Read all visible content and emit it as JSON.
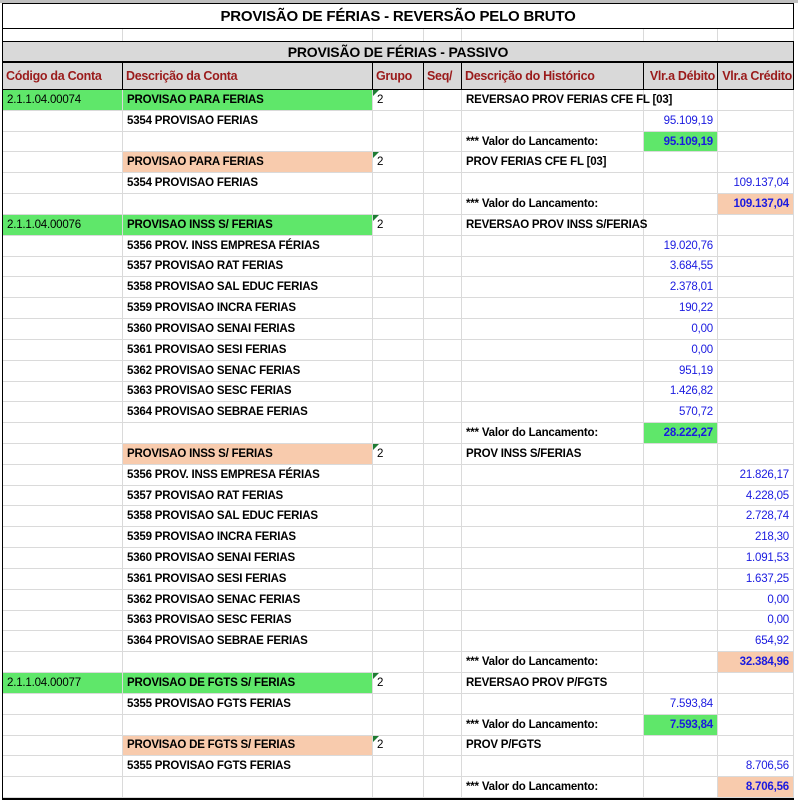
{
  "titles": {
    "main": "PROVISÃO DE FÉRIAS - REVERSÃO PELO BRUTO",
    "section": "PROVISÃO DE FÉRIAS - PASSIVO"
  },
  "columns": [
    {
      "label": "Código da Conta"
    },
    {
      "label": "Descrição da Conta"
    },
    {
      "label": "Grupo"
    },
    {
      "label": "Seq/"
    },
    {
      "label": "Descrição do Histórico"
    },
    {
      "label": "Vlr.a Débito"
    },
    {
      "label": "Vlr.a Crédito"
    }
  ],
  "colors": {
    "highlight_green": "#5FE76A",
    "highlight_orange": "#F8CBAD",
    "value_blue": "#1A1AE0",
    "header_text_red": "#9A1B1B",
    "header_bg_gray": "#D9D9D9",
    "error_indicator_green": "#1E7B33"
  },
  "rows": [
    {
      "code": "2.1.1.04.00074",
      "code_hl": "green",
      "desc": "PROVISAO PARA FERIAS",
      "desc_hl": "green",
      "grupo": "2",
      "hist": "REVERSAO PROV FERIAS CFE FL [03]"
    },
    {
      "desc": "5354 PROVISAO FERIAS",
      "debito": "95.109,19"
    },
    {
      "hist": "*** Valor do Lancamento:",
      "debito": "95.109,19",
      "debito_hl": "green",
      "total": true
    },
    {
      "desc": "PROVISAO PARA FERIAS",
      "desc_hl": "orange",
      "grupo": "2",
      "hist": "PROV FERIAS CFE FL [03]"
    },
    {
      "desc": "5354 PROVISAO FERIAS",
      "credito": "109.137,04"
    },
    {
      "hist": "*** Valor do Lancamento:",
      "credito": "109.137,04",
      "credito_hl": "orange",
      "total": true
    },
    {
      "code": "2.1.1.04.00076",
      "code_hl": "green",
      "desc": "PROVISAO INSS S/ FERIAS",
      "desc_hl": "green",
      "grupo": "2",
      "hist": "REVERSAO PROV INSS S/FERIAS"
    },
    {
      "desc": "5356 PROV. INSS EMPRESA FÉRIAS",
      "debito": "19.020,76"
    },
    {
      "desc": "5357 PROVISAO RAT FERIAS",
      "debito": "3.684,55"
    },
    {
      "desc": "5358 PROVISAO SAL EDUC FERIAS",
      "debito": "2.378,01"
    },
    {
      "desc": "5359 PROVISAO INCRA FERIAS",
      "debito": "190,22"
    },
    {
      "desc": "5360 PROVISAO SENAI FERIAS",
      "debito": "0,00"
    },
    {
      "desc": "5361 PROVISAO SESI FERIAS",
      "debito": "0,00"
    },
    {
      "desc": "5362 PROVISAO SENAC FERIAS",
      "debito": "951,19"
    },
    {
      "desc": "5363 PROVISAO SESC FERIAS",
      "debito": "1.426,82"
    },
    {
      "desc": "5364 PROVISAO SEBRAE FERIAS",
      "debito": "570,72"
    },
    {
      "hist": "*** Valor do Lancamento:",
      "debito": "28.222,27",
      "debito_hl": "green",
      "total": true
    },
    {
      "desc": "PROVISAO INSS S/ FERIAS",
      "desc_hl": "orange",
      "grupo": "2",
      "hist": "PROV INSS S/FERIAS"
    },
    {
      "desc": "5356 PROV. INSS EMPRESA FÉRIAS",
      "credito": "21.826,17"
    },
    {
      "desc": "5357 PROVISAO RAT FERIAS",
      "credito": "4.228,05"
    },
    {
      "desc": "5358 PROVISAO SAL EDUC FERIAS",
      "credito": "2.728,74"
    },
    {
      "desc": "5359 PROVISAO INCRA FERIAS",
      "credito": "218,30"
    },
    {
      "desc": "5360 PROVISAO SENAI FERIAS",
      "credito": "1.091,53"
    },
    {
      "desc": "5361 PROVISAO SESI FERIAS",
      "credito": "1.637,25"
    },
    {
      "desc": "5362 PROVISAO SENAC FERIAS",
      "credito": "0,00"
    },
    {
      "desc": "5363 PROVISAO SESC FERIAS",
      "credito": "0,00"
    },
    {
      "desc": "5364 PROVISAO SEBRAE FERIAS",
      "credito": "654,92"
    },
    {
      "hist": "*** Valor do Lancamento:",
      "credito": "32.384,96",
      "credito_hl": "orange",
      "total": true
    },
    {
      "code": "2.1.1.04.00077",
      "code_hl": "green",
      "desc": "PROVISAO DE FGTS S/ FERIAS",
      "desc_hl": "green",
      "grupo": "2",
      "hist": "REVERSAO PROV P/FGTS"
    },
    {
      "desc": "5355 PROVISAO FGTS FERIAS",
      "debito": "7.593,84"
    },
    {
      "hist": "*** Valor do Lancamento:",
      "debito": "7.593,84",
      "debito_hl": "green",
      "total": true
    },
    {
      "desc": "PROVISAO DE FGTS S/ FERIAS",
      "desc_hl": "orange",
      "grupo": "2",
      "hist": "PROV P/FGTS"
    },
    {
      "desc": "5355 PROVISAO FGTS FERIAS",
      "credito": "8.706,56"
    },
    {
      "hist": "*** Valor do Lancamento:",
      "credito": "8.706,56",
      "credito_hl": "orange",
      "total": true
    }
  ]
}
